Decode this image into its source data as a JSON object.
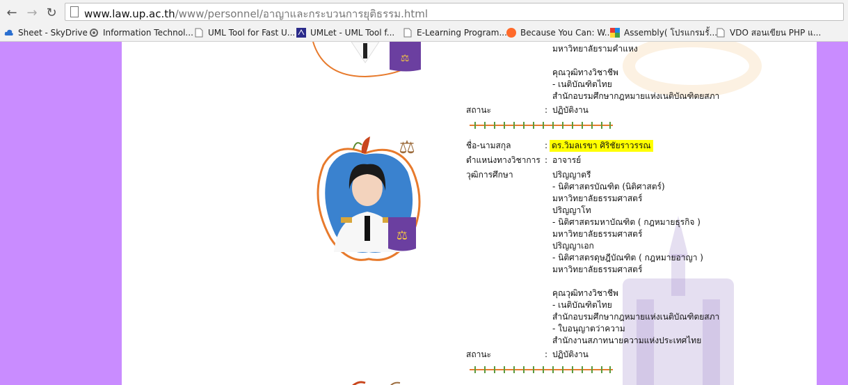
{
  "browser": {
    "url_host": "www.law.up.ac.th",
    "url_path": "/www/personnel/อาญาและกระบวนการยุติธรรม.html",
    "bookmarks": [
      {
        "label": "Sheet - SkyDrive",
        "icon": "cloud-icon"
      },
      {
        "label": "Information Technol...",
        "icon": "gear-icon"
      },
      {
        "label": "UML Tool for Fast U...",
        "icon": "page-icon"
      },
      {
        "label": "UMLet - UML Tool f...",
        "icon": "umlet-icon"
      },
      {
        "label": "E-Learning Program...",
        "icon": "page-icon"
      },
      {
        "label": "Because You Can: W...",
        "icon": "orange-circle-icon"
      },
      {
        "label": "Assembly( โปรแกรมรั้...",
        "icon": "colorful-icon"
      },
      {
        "label": "VDO สอนเขียน PHP แ...",
        "icon": "page-icon"
      }
    ]
  },
  "person1": {
    "edu_tail": [
      "มหาวิทยาลัยรามคำแหง",
      "",
      "คุณวุฒิทางวิชาชีพ",
      "- เนติบัณฑิตไทย",
      "สำนักอบรมศึกษากฎหมายแห่งเนติบัณฑิตยสภา"
    ],
    "status_label": "สถานะ",
    "status_value": "ปฏิบัติงาน"
  },
  "person2": {
    "name_label": "ชื่อ-นามสกุล",
    "name_value": "ดร.วิมลเรขา ศิริชัยราวรรณ",
    "position_label": "ตำแหน่งทางวิชาการ",
    "position_value": "อาจารย์",
    "education_label": "วุฒิการศึกษา",
    "education_lines": [
      "ปริญญาตรี",
      "- นิติศาสตรบัณฑิต (นิติศาสตร์)",
      "มหาวิทยาลัยธรรมศาสตร์",
      "ปริญญาโท",
      "- นิติศาสตรมหาบัณฑิต ( กฎหมายธุรกิจ )",
      "มหาวิทยาลัยธรรมศาสตร์",
      "ปริญญาเอก",
      "- นิติศาสตรดุษฎีบัณฑิต ( กฎหมายอาญา )",
      "มหาวิทยาลัยธรรมศาสตร์",
      "",
      "คุณวุฒิทางวิชาชีพ",
      "- เนติบัณฑิตไทย",
      "สำนักอบรมศึกษากฎหมายแห่งเนติบัณฑิตยสภา",
      "- ใบอนุญาตว่าความ",
      "สำนักงานสภาทนายความแห่งประเทศไทย"
    ],
    "status_label": "สถานะ",
    "status_value": "ปฏิบัติงาน"
  },
  "colon": ":"
}
